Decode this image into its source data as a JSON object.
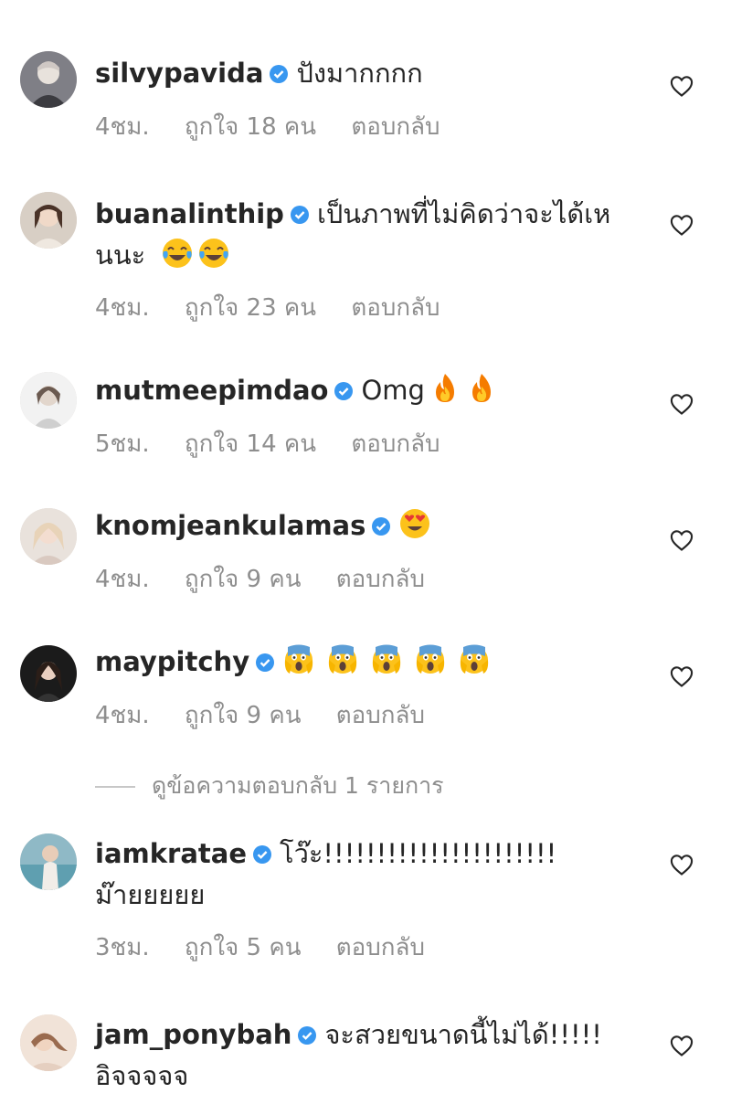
{
  "comments": [
    {
      "username": "silvypavida",
      "verified": true,
      "text": "ปังมากกกก",
      "emojis": [],
      "time": "4ชม.",
      "likes": "ถูกใจ 18 คน",
      "reply_label": "ตอบกลับ"
    },
    {
      "username": "buanalinthip",
      "verified": true,
      "text": "เป็นภาพที่ไม่คิดว่าจะได้เหนนะ",
      "emojis": [
        "face-with-tears-of-joy",
        "face-with-tears-of-joy"
      ],
      "time": "4ชม.",
      "likes": "ถูกใจ 23 คน",
      "reply_label": "ตอบกลับ"
    },
    {
      "username": "mutmeepimdao",
      "verified": true,
      "text": "Omg",
      "emojis": [
        "fire",
        "fire"
      ],
      "time": "5ชม.",
      "likes": "ถูกใจ 14 คน",
      "reply_label": "ตอบกลับ"
    },
    {
      "username": "knomjeankulamas",
      "verified": true,
      "text": "",
      "emojis": [
        "heart-eyes"
      ],
      "time": "4ชม.",
      "likes": "ถูกใจ 9 คน",
      "reply_label": "ตอบกลับ"
    },
    {
      "username": "maypitchy",
      "verified": true,
      "text": "",
      "emojis": [
        "face-screaming-in-fear",
        "face-screaming-in-fear",
        "face-screaming-in-fear",
        "face-screaming-in-fear",
        "face-screaming-in-fear"
      ],
      "time": "4ชม.",
      "likes": "ถูกใจ 9 คน",
      "reply_label": "ตอบกลับ"
    },
    {
      "username": "iamkratae",
      "verified": true,
      "text": "โว๊ะ!!!!!!!!!!!!!!!!!!!!!! ม๊ายยยยย",
      "emojis": [],
      "time": "3ชม.",
      "likes": "ถูกใจ 5 คน",
      "reply_label": "ตอบกลับ"
    },
    {
      "username": "jam_ponybah",
      "verified": true,
      "text": "จะสวยขนาดนี้ไม่ได้!!!!! อิจจจจจ",
      "emojis": [],
      "time": "",
      "likes": "",
      "reply_label": ""
    }
  ],
  "view_replies_label": "ดูข้อความตอบกลับ 1 รายการ",
  "colors": {
    "verified": "#3897f0",
    "meta_text": "#8e8e8e",
    "username": "#262626"
  }
}
